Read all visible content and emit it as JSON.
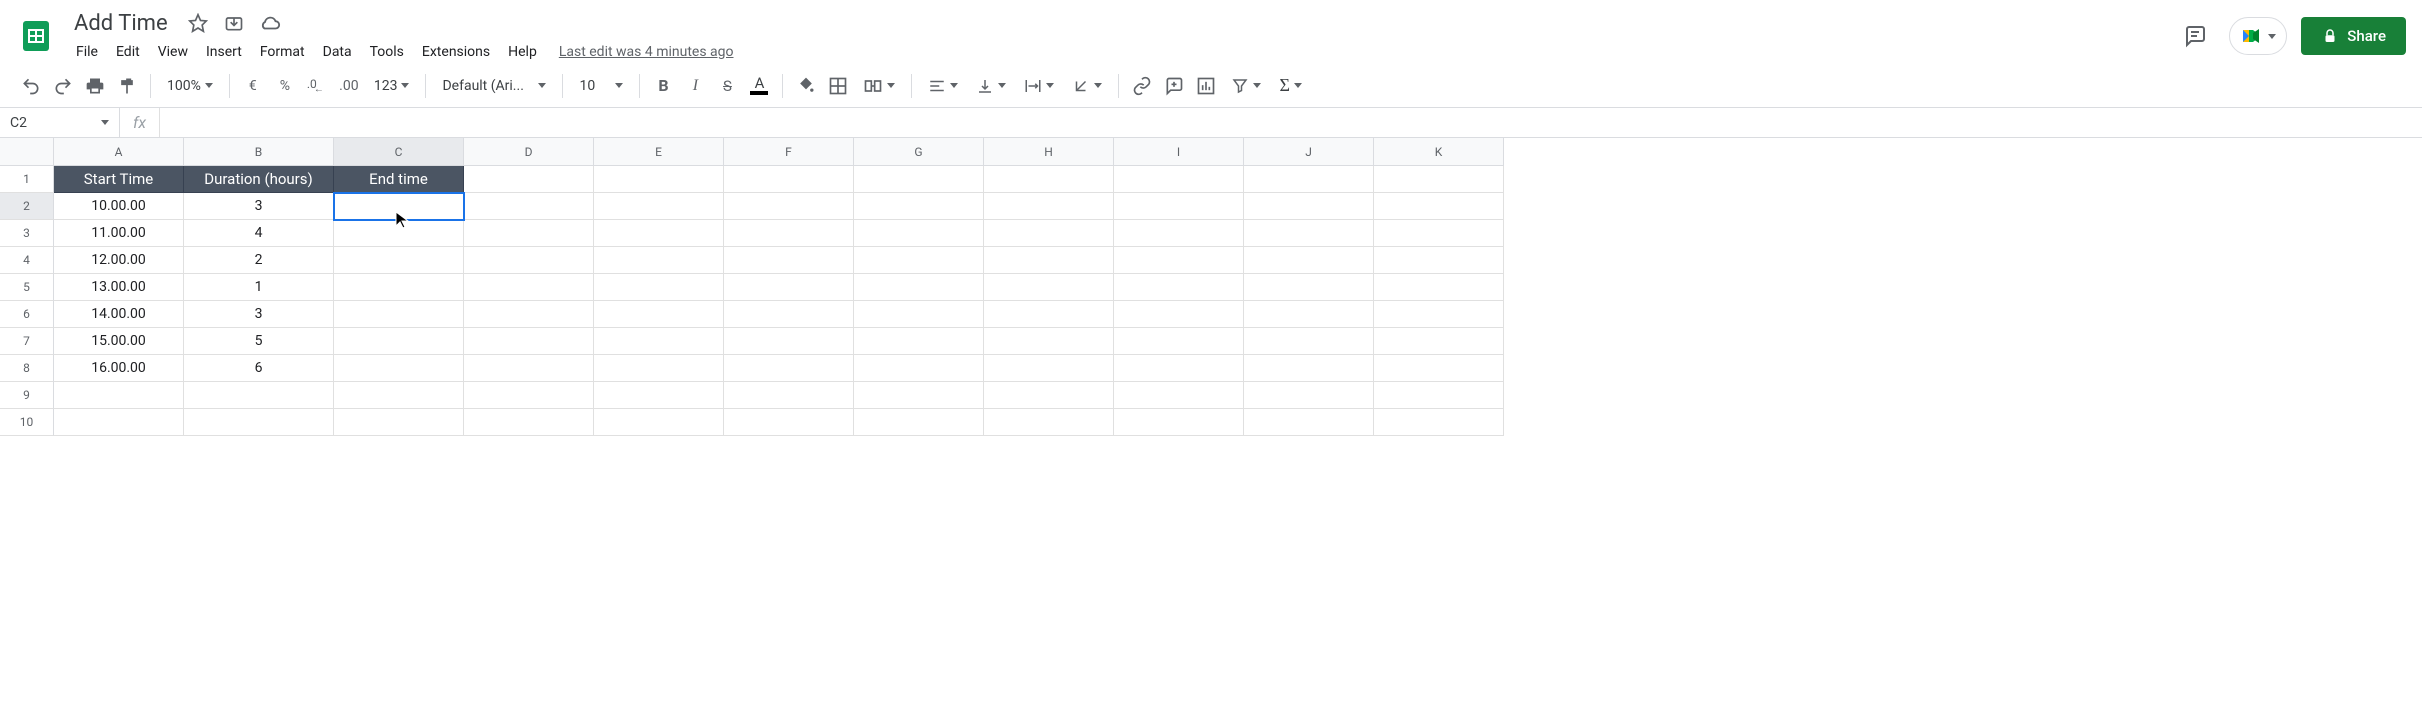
{
  "document": {
    "title": "Add Time"
  },
  "menus": [
    "File",
    "Edit",
    "View",
    "Insert",
    "Format",
    "Data",
    "Tools",
    "Extensions",
    "Help"
  ],
  "last_edit": "Last edit was 4 minutes ago",
  "share_label": "Share",
  "toolbar": {
    "zoom": "100%",
    "currency": "€",
    "percent": "%",
    "dec_dec": ".0",
    "inc_dec": ".00",
    "more_fmt": "123",
    "font": "Default (Ari...",
    "font_size": "10"
  },
  "namebox": "C2",
  "fx_label": "fx",
  "formula": "",
  "columns": [
    "A",
    "B",
    "C",
    "D",
    "E",
    "F",
    "G",
    "H",
    "I",
    "J",
    "K"
  ],
  "rows": [
    "1",
    "2",
    "3",
    "4",
    "5",
    "6",
    "7",
    "8",
    "9",
    "10"
  ],
  "headers": {
    "A": "Start Time",
    "B": "Duration (hours)",
    "C": "End time"
  },
  "chart_data": {
    "type": "table",
    "columns": [
      "Start Time",
      "Duration (hours)",
      "End time"
    ],
    "rows": [
      [
        "10.00.00",
        "3",
        ""
      ],
      [
        "11.00.00",
        "4",
        ""
      ],
      [
        "12.00.00",
        "2",
        ""
      ],
      [
        "13.00.00",
        "1",
        ""
      ],
      [
        "14.00.00",
        "3",
        ""
      ],
      [
        "15.00.00",
        "5",
        ""
      ],
      [
        "16.00.00",
        "6",
        ""
      ]
    ]
  },
  "selected_cell": "C2",
  "selected_col": "C",
  "selected_row": "2"
}
